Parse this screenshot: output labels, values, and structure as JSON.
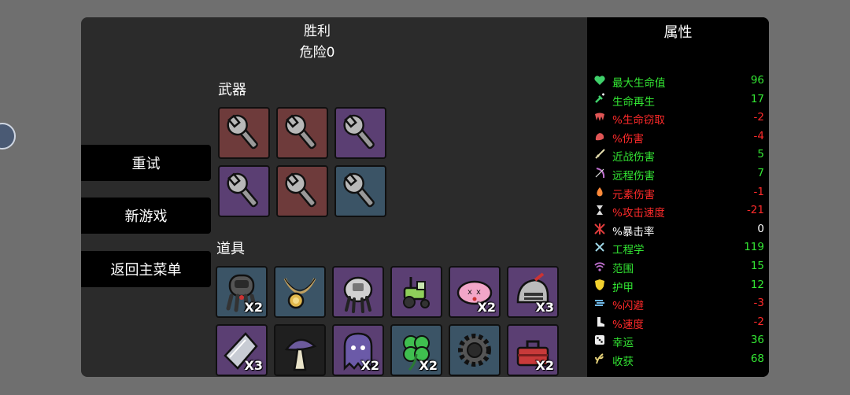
{
  "header": {
    "title": "胜利",
    "subtitle": "危险0"
  },
  "menu": {
    "retry": "重试",
    "new_game": "新游戏",
    "main_menu": "返回主菜单"
  },
  "weapons": {
    "label": "武器",
    "items": [
      {
        "icon": "wrench-icon",
        "bg": "#6e3b3b"
      },
      {
        "icon": "wrench-icon",
        "bg": "#6e3b3b"
      },
      {
        "icon": "wrench-icon",
        "bg": "#5b3f73"
      },
      {
        "icon": "wrench-icon",
        "bg": "#5b3f73"
      },
      {
        "icon": "wrench-icon",
        "bg": "#6e3b3b"
      },
      {
        "icon": "wrench-icon",
        "bg": "#3b5466"
      }
    ]
  },
  "items": {
    "label": "道具",
    "list": [
      {
        "icon": "diving-helmet-icon",
        "bg": "#3b5466",
        "qty": "X2"
      },
      {
        "icon": "amulet-icon",
        "bg": "#3b5466",
        "qty": ""
      },
      {
        "icon": "robot-claw-icon",
        "bg": "#5b3f73",
        "qty": ""
      },
      {
        "icon": "tractor-icon",
        "bg": "#5b3f73",
        "qty": ""
      },
      {
        "icon": "pink-blob-icon",
        "bg": "#5b3f73",
        "qty": "X2"
      },
      {
        "icon": "knight-helmet-icon",
        "bg": "#5b3f73",
        "qty": "X3"
      },
      {
        "icon": "metal-plate-icon",
        "bg": "#5b3f73",
        "qty": "X3"
      },
      {
        "icon": "mushroom-icon",
        "bg": "#1f1f1f",
        "qty": ""
      },
      {
        "icon": "ghost-icon",
        "bg": "#5b3f73",
        "qty": "X2"
      },
      {
        "icon": "clover-icon",
        "bg": "#3b5466",
        "qty": "X2"
      },
      {
        "icon": "gear-icon",
        "bg": "#3b5466",
        "qty": ""
      },
      {
        "icon": "toolbox-icon",
        "bg": "#5b3f73",
        "qty": "X2"
      }
    ]
  },
  "stats": {
    "title": "属性",
    "rows": [
      {
        "icon": "heart-icon",
        "name": "最大生命值",
        "value": "96",
        "color": "#33e633"
      },
      {
        "icon": "regen-icon",
        "name": "生命再生",
        "value": "17",
        "color": "#33e633"
      },
      {
        "icon": "fang-icon",
        "name": "%生命窃取",
        "value": "-2",
        "color": "#ff2a2a"
      },
      {
        "icon": "muscle-icon",
        "name": "%伤害",
        "value": "-4",
        "color": "#ff2a2a"
      },
      {
        "icon": "sword-icon",
        "name": "近战伤害",
        "value": "5",
        "color": "#33e633"
      },
      {
        "icon": "bow-icon",
        "name": "远程伤害",
        "value": "7",
        "color": "#33e633"
      },
      {
        "icon": "flame-icon",
        "name": "元素伤害",
        "value": "-1",
        "color": "#ff2a2a"
      },
      {
        "icon": "hourglass-icon",
        "name": "%攻击速度",
        "value": "-21",
        "color": "#ff2a2a"
      },
      {
        "icon": "crit-icon",
        "name": "%暴击率",
        "value": "0",
        "color": "#ffffff"
      },
      {
        "icon": "wrench-cross-icon",
        "name": "工程学",
        "value": "119",
        "color": "#33e633"
      },
      {
        "icon": "range-icon",
        "name": "范围",
        "value": "15",
        "color": "#33e633"
      },
      {
        "icon": "shield-icon",
        "name": "护甲",
        "value": "12",
        "color": "#33e633"
      },
      {
        "icon": "dodge-icon",
        "name": "%闪避",
        "value": "-3",
        "color": "#ff2a2a"
      },
      {
        "icon": "boot-icon",
        "name": "%速度",
        "value": "-2",
        "color": "#ff2a2a"
      },
      {
        "icon": "dice-icon",
        "name": "幸运",
        "value": "36",
        "color": "#33e633"
      },
      {
        "icon": "harvest-icon",
        "name": "收获",
        "value": "68",
        "color": "#33e633"
      }
    ]
  }
}
